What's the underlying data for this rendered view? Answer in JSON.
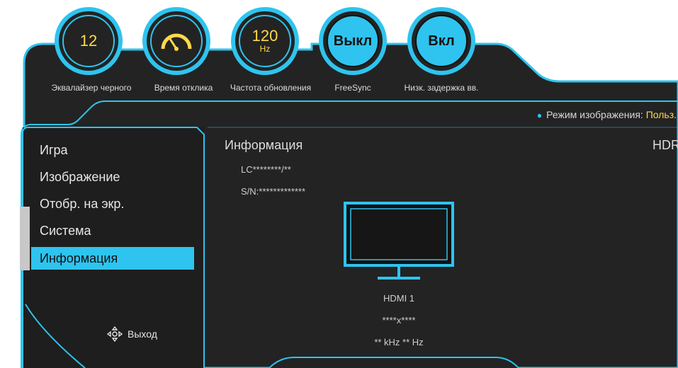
{
  "gauges": [
    {
      "value": "12",
      "label": "Эквалайзер черного"
    },
    {
      "value": "",
      "label": "Время отклика",
      "icon": "speedometer-icon"
    },
    {
      "value": "120",
      "unit": "Hz",
      "label": "Частота обновления"
    },
    {
      "value": "Выкл",
      "label": "FreeSync"
    },
    {
      "value": "Вкл",
      "label": "Низк. задержка вв."
    }
  ],
  "picture_mode": {
    "label": "Режим изображения:",
    "value": "Польз."
  },
  "menu": {
    "items": [
      {
        "label": "Игра"
      },
      {
        "label": "Изображение"
      },
      {
        "label": "Отобр. на экр."
      },
      {
        "label": "Система"
      },
      {
        "label": "Информация"
      }
    ],
    "active_index": 4
  },
  "exit_label": "Выход",
  "info": {
    "title": "Информация",
    "hdr": "HDR",
    "model": "LC********/**",
    "serial": "S/N:*************",
    "source": "HDMI 1",
    "resolution": "****x****",
    "frequency": "** kHz ** Hz"
  },
  "colors": {
    "accent": "#2ec4ef",
    "highlight": "#ffd94a",
    "panel": "#232323"
  }
}
